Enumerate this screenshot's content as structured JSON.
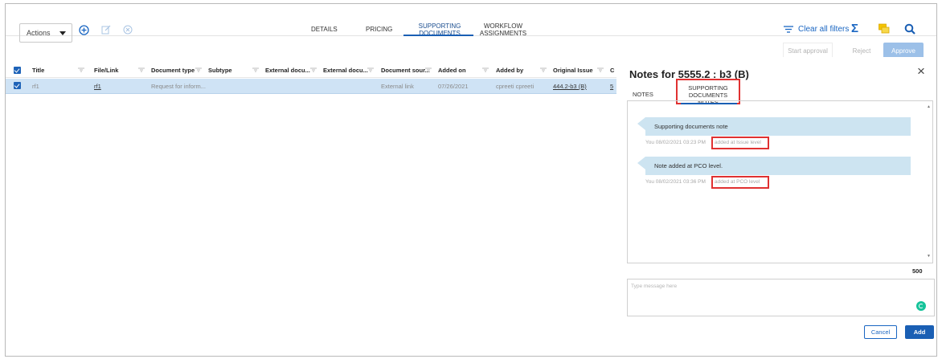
{
  "toolbar": {
    "actions_label": "Actions",
    "tabs": [
      {
        "label": "DETAILS"
      },
      {
        "label": "PRICING"
      },
      {
        "label": "SUPPORTING DOCUMENTS"
      },
      {
        "label": "WORKFLOW ASSIGNMENTS"
      }
    ],
    "clear_filters_label": "Clear all filters",
    "sigma": "Σ"
  },
  "approval": {
    "start_label": "Start approval",
    "reject_label": "Reject",
    "approve_label": "Approve"
  },
  "grid": {
    "columns": [
      "Title",
      "File/Link",
      "Document type",
      "Subtype",
      "External docu...",
      "External docu...",
      "Document sour...",
      "Added on",
      "Added by",
      "Original Issue",
      "C"
    ],
    "rows": [
      {
        "title": "rf1",
        "file_link": "rf1",
        "document_type": "Request for inform...",
        "subtype": "",
        "external_doc_1": "",
        "external_doc_2": "",
        "document_source": "External link",
        "added_on": "07/26/2021",
        "added_by": "cpreeti cpreeti",
        "original_issue": "444.2-b3 (B)",
        "c": "5"
      }
    ]
  },
  "notes_panel": {
    "title": "Notes for 5555.2 : b3 (B)",
    "close_icon": "×",
    "tabs": [
      {
        "label": "NOTES"
      },
      {
        "label": "SUPPORTING DOCUMENTS NOTES"
      }
    ],
    "notes": [
      {
        "text": "Supporting documents note",
        "meta": "You 08/02/2021 03:23 PM",
        "level": "added at Issue level"
      },
      {
        "text": "Note added at PCO level.",
        "meta": "You 08/02/2021 03:36 PM",
        "level": "added at PCO level"
      }
    ],
    "counter": "500",
    "message_placeholder": "Type message here",
    "cancel_label": "Cancel",
    "add_label": "Add"
  },
  "colors": {
    "accent": "#1a5fb4",
    "selected_row": "#cfe3f5",
    "bubble": "#cde4f1",
    "highlight_red": "#e03131"
  }
}
